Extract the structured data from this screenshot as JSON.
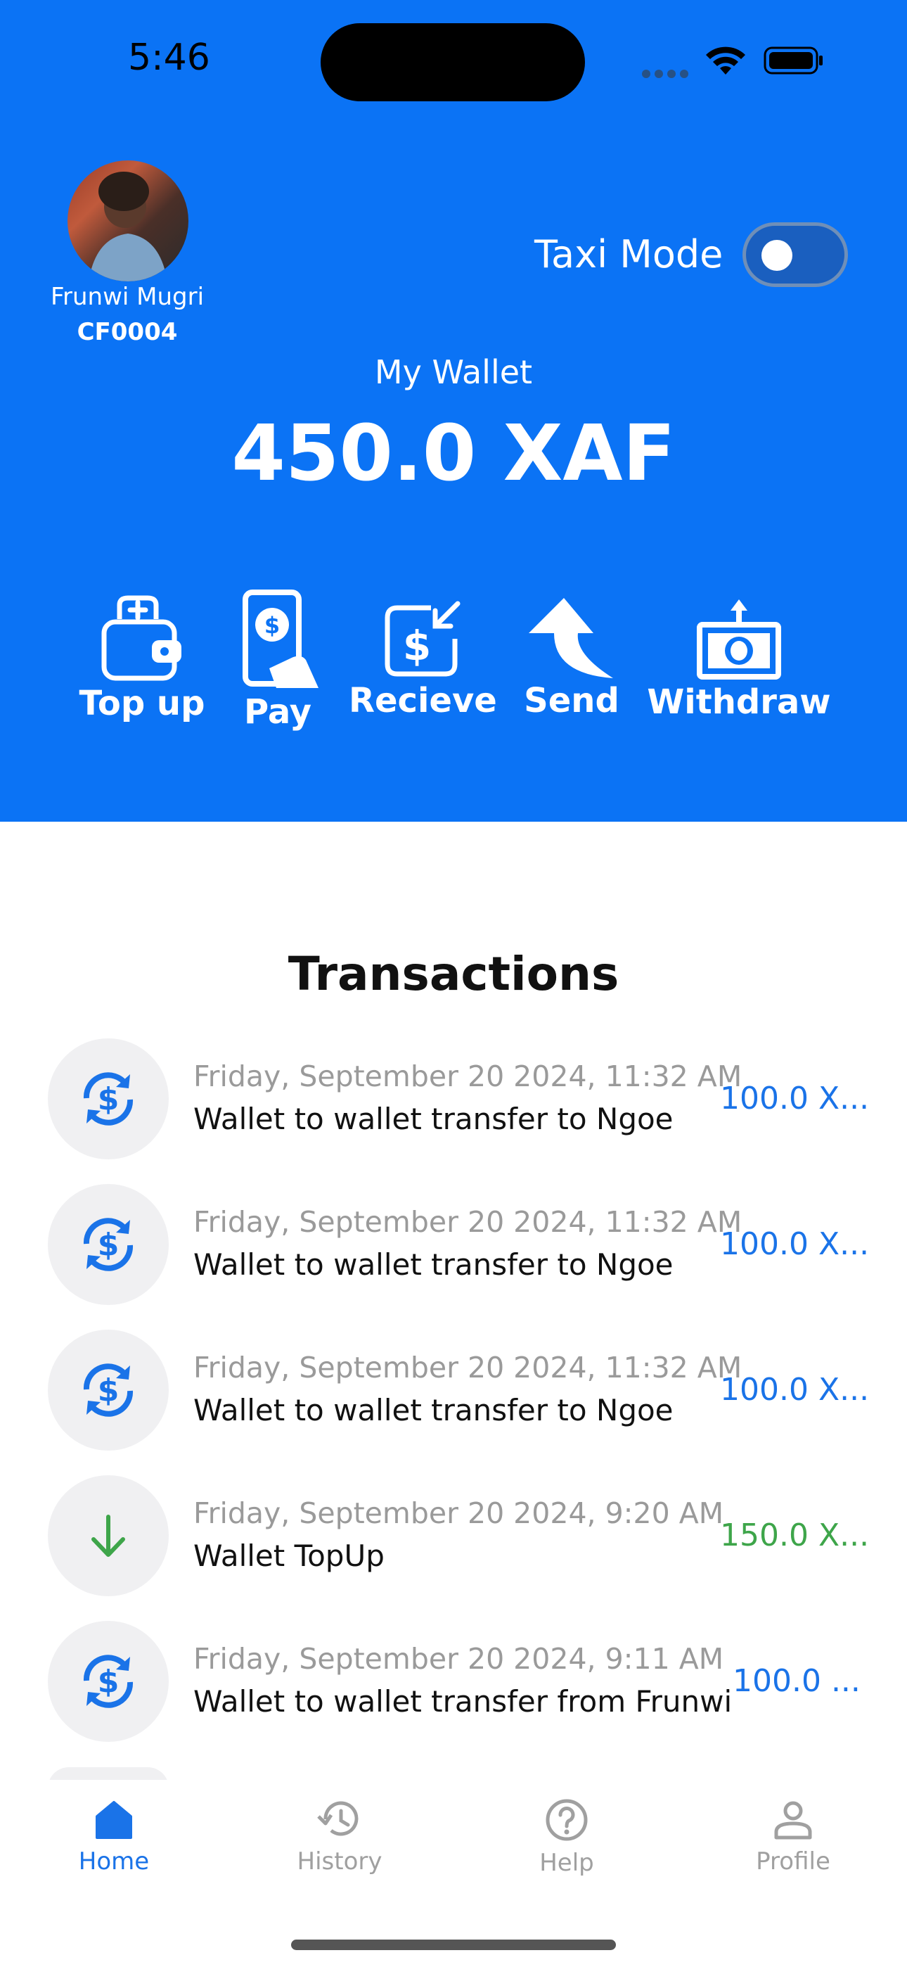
{
  "status_bar": {
    "time": "5:46"
  },
  "user": {
    "name": "Frunwi Mugri",
    "id": "CF0004"
  },
  "taxi_mode": {
    "label": "Taxi Mode",
    "enabled": false
  },
  "wallet": {
    "label": "My Wallet",
    "amount": "450.0 XAF"
  },
  "actions": [
    {
      "label": "Top up",
      "icon": "wallet-plus-icon"
    },
    {
      "label": "Pay",
      "icon": "phone-pay-icon"
    },
    {
      "label": "Recieve",
      "icon": "receive-money-icon"
    },
    {
      "label": "Send",
      "icon": "send-arrow-icon"
    },
    {
      "label": "Withdraw",
      "icon": "withdraw-cash-icon"
    }
  ],
  "transactions": {
    "title": "Transactions",
    "items": [
      {
        "date": "Friday, September 20 2024, 11:32 AM",
        "description": "Wallet to wallet transfer to Ngoe",
        "amount": "100.0 X...",
        "icon": "transfer-dollar-icon",
        "color": "#1a73e8"
      },
      {
        "date": "Friday, September 20 2024, 11:32 AM",
        "description": "Wallet to wallet transfer to Ngoe",
        "amount": "100.0 X...",
        "icon": "transfer-dollar-icon",
        "color": "#1a73e8"
      },
      {
        "date": "Friday, September 20 2024, 11:32 AM",
        "description": "Wallet to wallet transfer to Ngoe",
        "amount": "100.0 X...",
        "icon": "transfer-dollar-icon",
        "color": "#1a73e8"
      },
      {
        "date": "Friday, September 20 2024, 9:20 AM",
        "description": "Wallet TopUp",
        "amount": "150.0 X...",
        "icon": "arrow-down-icon",
        "color": "#3ea54a"
      },
      {
        "date": "Friday, September 20 2024, 9:11 AM",
        "description": "Wallet to wallet transfer from Frunwi",
        "amount": "100.0 ...",
        "icon": "transfer-dollar-icon",
        "color": "#1a73e8"
      }
    ]
  },
  "tabs": [
    {
      "label": "Home",
      "icon": "home-icon",
      "active": true
    },
    {
      "label": "History",
      "icon": "history-icon",
      "active": false
    },
    {
      "label": "Help",
      "icon": "help-icon",
      "active": false
    },
    {
      "label": "Profile",
      "icon": "profile-icon",
      "active": false
    }
  ],
  "colors": {
    "primary": "#0b73f5",
    "accent_blue": "#1a73e8",
    "accent_green": "#3ea54a",
    "inactive": "#a0a0a0"
  }
}
